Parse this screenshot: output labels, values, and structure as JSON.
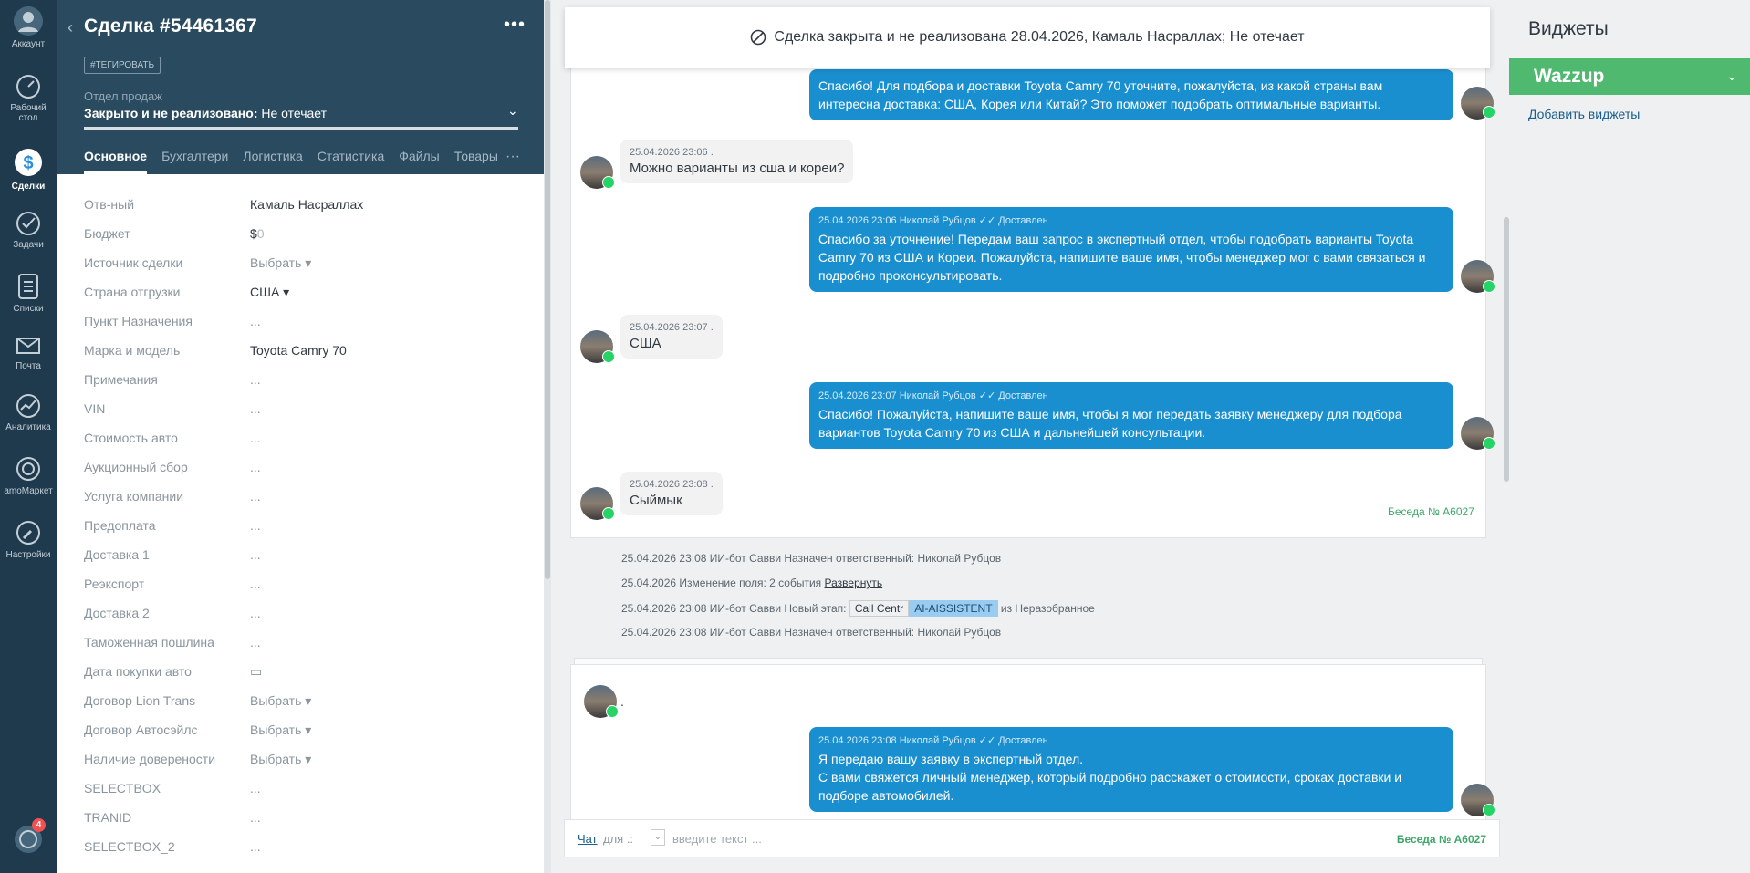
{
  "nav": {
    "account": "Аккаунт",
    "dashboard": "Рабочий стол",
    "deals": "Сделки",
    "tasks": "Задачи",
    "lists": "Списки",
    "mail": "Почта",
    "analytics": "Аналитика",
    "market": "amoМаркет",
    "settings": "Настройки",
    "chat_badge": "4"
  },
  "deal": {
    "title": "Сделка #54461367",
    "more": "•••",
    "tag_button": "#ТЕГИРОВАТЬ",
    "pipeline": "Отдел продаж",
    "status_bold": "Закрыто и не реализовано:",
    "status_reason": "Не отечает",
    "tabs": [
      "Основное",
      "Бухгалтери",
      "Логистика",
      "Статистика",
      "Файлы",
      "Товары"
    ],
    "tabs_more": "···",
    "fields": [
      {
        "label": "Отв-ный",
        "value": "Камаль Насраллах"
      },
      {
        "label": "Бюджет",
        "value": "$",
        "zero": "0"
      },
      {
        "label": "Источник сделки",
        "value": "Выбрать ▾"
      },
      {
        "label": "Страна отгрузки",
        "value": "США ▾"
      },
      {
        "label": "Пункт Назначения",
        "value": "..."
      },
      {
        "label": "Марка и модель",
        "value": "Toyota Camry 70"
      },
      {
        "label": "Примечания",
        "value": "..."
      },
      {
        "label": "VIN",
        "value": "..."
      },
      {
        "label": "Стоимость авто",
        "value": "..."
      },
      {
        "label": "Аукционный сбор",
        "value": "..."
      },
      {
        "label": "Услуга компании",
        "value": "..."
      },
      {
        "label": "Предоплата",
        "value": "..."
      },
      {
        "label": "Доставка 1",
        "value": "..."
      },
      {
        "label": "Реэкспорт",
        "value": "..."
      },
      {
        "label": "Доставка 2",
        "value": "..."
      },
      {
        "label": "Таможенная пошлина",
        "value": "..."
      },
      {
        "label": "Дата покупки авто",
        "value": "▭"
      },
      {
        "label": "Договор Lion Trans",
        "value": "Выбрать ▾"
      },
      {
        "label": "Договор Автосэйлс",
        "value": "Выбрать ▾"
      },
      {
        "label": "Наличие доверености",
        "value": "Выбрать ▾"
      },
      {
        "label": "SELECTBOX",
        "value": "..."
      },
      {
        "label": "TRANID",
        "value": "..."
      },
      {
        "label": "SELECTBOX_2",
        "value": "..."
      }
    ]
  },
  "feed": {
    "closed_banner": "Сделка закрыта и не реализована 28.04.2026, Камаль Насраллах; Не отечает",
    "messages": [
      {
        "dir": "out",
        "meta": "",
        "text": "Спасибо! Для подбора и доставки Toyota Camry 70 уточните, пожалуйста, из какой страны вам интересна доставка: США, Корея или Китай? Это поможет подобрать оптимальные варианты."
      },
      {
        "dir": "in",
        "meta": "25.04.2026 23:06 .",
        "text": "Можно варианты из сша и кореи?"
      },
      {
        "dir": "out",
        "meta": "25.04.2026 23:06 Николай Рубцов",
        "status": "Доставлен",
        "text": "Спасибо за уточнение! Передам ваш запрос в экспертный отдел, чтобы подобрать варианты Toyota Camry 70 из США и Кореи. Пожалуйста, напишите ваше имя, чтобы менеджер мог с вами связаться и подробно проконсультировать."
      },
      {
        "dir": "in",
        "meta": "25.04.2026 23:07 .",
        "text": "США"
      },
      {
        "dir": "out",
        "meta": "25.04.2026 23:07 Николай Рубцов",
        "status": "Доставлен",
        "text": "Спасибо! Пожалуйста, напишите ваше имя, чтобы я мог передать заявку менеджеру для подбора вариантов Toyota Camry 70 из США и дальнейшей консультации."
      },
      {
        "dir": "in",
        "meta": "25.04.2026 23:08 .",
        "text": "Сыймык"
      }
    ],
    "conversation_no": "Беседа № A6027",
    "events": {
      "e1": "25.04.2026 23:08 ИИ-бот Савви Назначен ответственный: Николай Рубцов",
      "e2_prefix": "25.04.2026 Изменение поля: 2 события",
      "e2_link": "Развернуть",
      "e3_prefix": "25.04.2026 23:08 ИИ-бот Савви Новый этап:",
      "e3_chip1": "Call Centr",
      "e3_chip2": "AI-AISSISTENT",
      "e3_suffix": "из Неразобранное",
      "e4": "25.04.2026 23:08 ИИ-бот Савви Назначен ответственный: Николай Рубцов"
    },
    "card2": {
      "sender_dot": ".",
      "meta": "25.04.2026 23:08 Николай Рубцов",
      "status": "Доставлен",
      "line1": "Я передаю вашу заявку в экспертный отдел.",
      "line2": "С вами свяжется личный менеджер, который подробно расскажет о стоимости, сроках доставки и подборе автомобилей."
    },
    "input": {
      "chat_label": "Чат",
      "for_label": "для .:",
      "placeholder": "введите текст ...",
      "conversation": "Беседа № A6027"
    }
  },
  "widgets": {
    "title": "Виджеты",
    "wazzup": "Wazzup",
    "add": "Добавить виджеты"
  }
}
